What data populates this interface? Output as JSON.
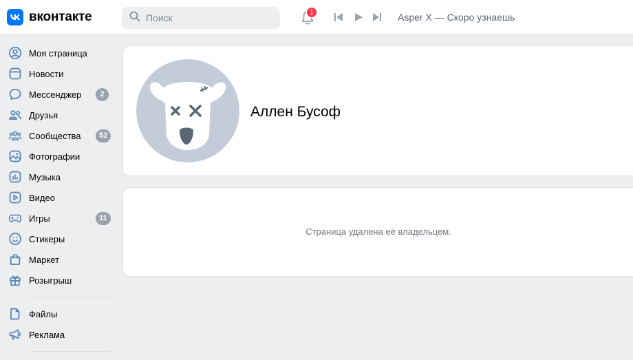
{
  "header": {
    "logo_text": "вконтакте",
    "search_placeholder": "Поиск",
    "notifications_count": "1",
    "now_playing": "Asper X — Скоро узнаешь"
  },
  "sidebar": {
    "items": [
      {
        "label": "Моя страница",
        "icon": "user-circle-icon"
      },
      {
        "label": "Новости",
        "icon": "news-icon"
      },
      {
        "label": "Мессенджер",
        "icon": "message-icon",
        "badge": "2"
      },
      {
        "label": "Друзья",
        "icon": "friends-icon"
      },
      {
        "label": "Сообщества",
        "icon": "communities-icon",
        "badge": "52"
      },
      {
        "label": "Фотографии",
        "icon": "photo-icon"
      },
      {
        "label": "Музыка",
        "icon": "music-icon"
      },
      {
        "label": "Видео",
        "icon": "video-icon"
      },
      {
        "label": "Игры",
        "icon": "gamepad-icon",
        "badge": "11"
      },
      {
        "label": "Стикеры",
        "icon": "smile-icon"
      },
      {
        "label": "Маркет",
        "icon": "bag-icon"
      },
      {
        "label": "Розыгрыш",
        "icon": "gift-icon"
      }
    ],
    "secondary": [
      {
        "label": "Файлы",
        "icon": "file-icon"
      },
      {
        "label": "Реклама",
        "icon": "megaphone-icon"
      }
    ]
  },
  "profile": {
    "name": "Аллен Бусоф",
    "deleted_message": "Страница удалена её владельцем."
  },
  "colors": {
    "accent": "#0077ff",
    "icon": "#5181b8",
    "badge": "#99a2ad",
    "notification": "#ff3347"
  }
}
